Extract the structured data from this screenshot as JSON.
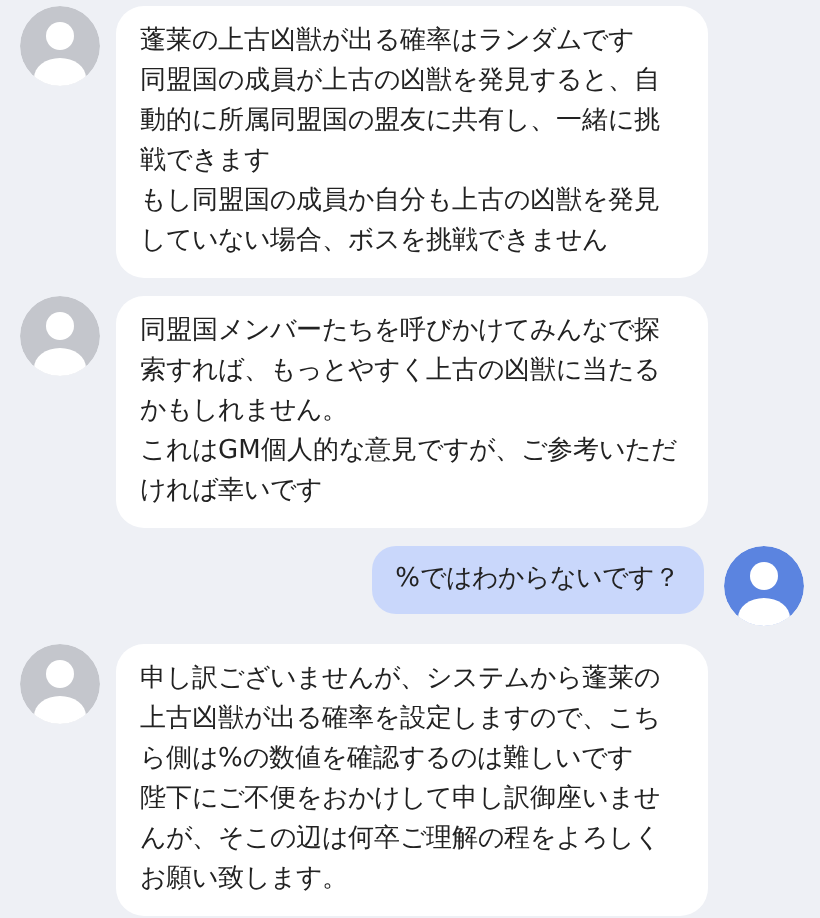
{
  "messages": [
    {
      "kind": "incoming",
      "paragraphs": [
        "蓬莱の上古凶獣が出る確率はランダムです",
        "同盟国の成員が上古の凶獣を発見すると、自動的に所属同盟国の盟友に共有し、一緒に挑戦できます",
        "もし同盟国の成員か自分も上古の凶獣を発見していない場合、ボスを挑戦できません"
      ]
    },
    {
      "kind": "incoming",
      "paragraphs": [
        "同盟国メンバーたちを呼びかけてみんなで探索すれば、もっとやすく上古の凶獣に当たるかもしれません。",
        "これはGM個人的な意見ですが、ご参考いただければ幸いです"
      ]
    },
    {
      "kind": "outgoing",
      "paragraphs": [
        "%ではわからないです？"
      ]
    },
    {
      "kind": "incoming",
      "paragraphs": [
        "申し訳ございませんが、システムから蓬莱の上古凶獣が出る確率を設定しますので、こちら側は%の数値を確認するのは難しいです",
        "陛下にご不便をおかけして申し訳御座いませんが、そこの辺は何卒ご理解の程をよろしくお願い致します。"
      ]
    }
  ]
}
